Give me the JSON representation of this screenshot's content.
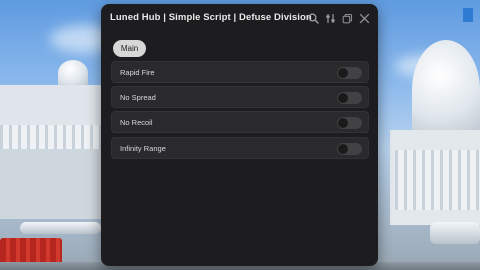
{
  "window": {
    "title": "Luned Hub | Simple Script | Defuse Division",
    "icons": [
      "search-icon",
      "settings-sliders-icon",
      "minimize-icon",
      "close-icon"
    ]
  },
  "tabs": [
    {
      "label": "Main",
      "selected": true
    }
  ],
  "toggles": [
    {
      "label": "Rapid Fire",
      "enabled": false
    },
    {
      "label": "No Spread",
      "enabled": false
    },
    {
      "label": "No Recoil",
      "enabled": false
    },
    {
      "label": "Infinity Range",
      "enabled": false
    }
  ],
  "colors": {
    "window_bg": "#1d1d1f",
    "row_bg": "#2a2a2c",
    "tab_bg": "#d7d7d7",
    "text": "#d9d9da"
  }
}
